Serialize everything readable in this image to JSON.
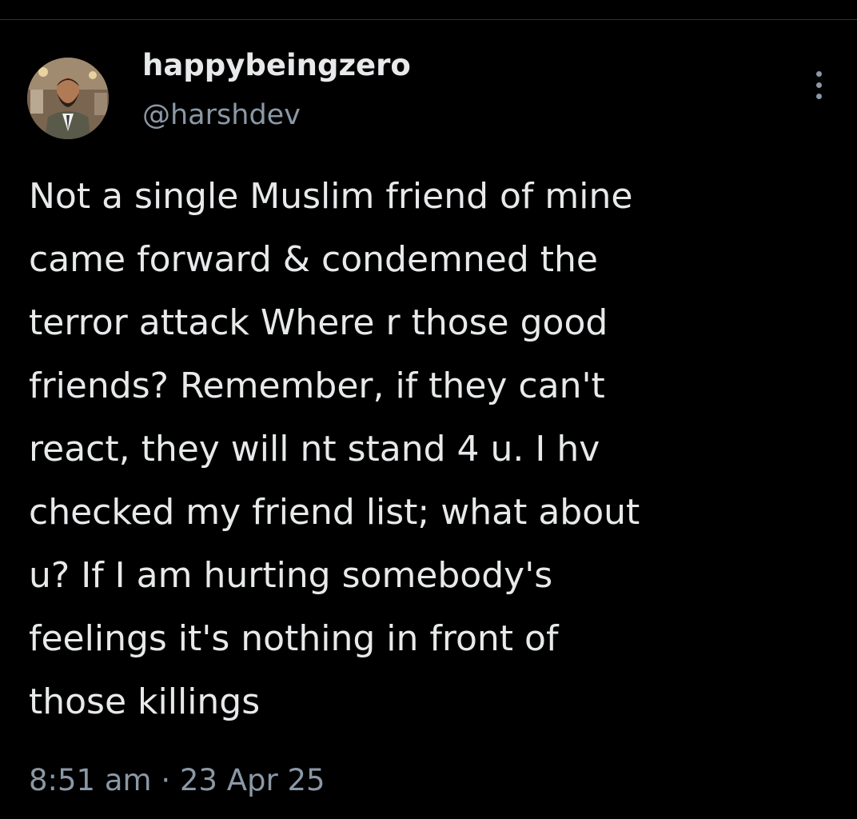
{
  "tweet": {
    "author": {
      "display_name": "happybeingzero",
      "handle": "@harshdev"
    },
    "text_lines": [
      "Not a single Muslim friend of mine",
      "came forward & condemned the",
      "terror attack Where r those good",
      "friends? Remember, if they can't",
      "react, they will nt stand 4 u. I hv",
      "checked my friend list; what about",
      "u? If I am hurting somebody's",
      "feelings it's nothing in front of",
      "those killings"
    ],
    "time": "8:51 am",
    "separator": "·",
    "date": "23 Apr 25"
  },
  "icons": {
    "more": "more-vertical-icon"
  },
  "colors": {
    "background": "#000000",
    "primary_text": "#e7e9ea",
    "secondary_text": "#8b98a5"
  }
}
